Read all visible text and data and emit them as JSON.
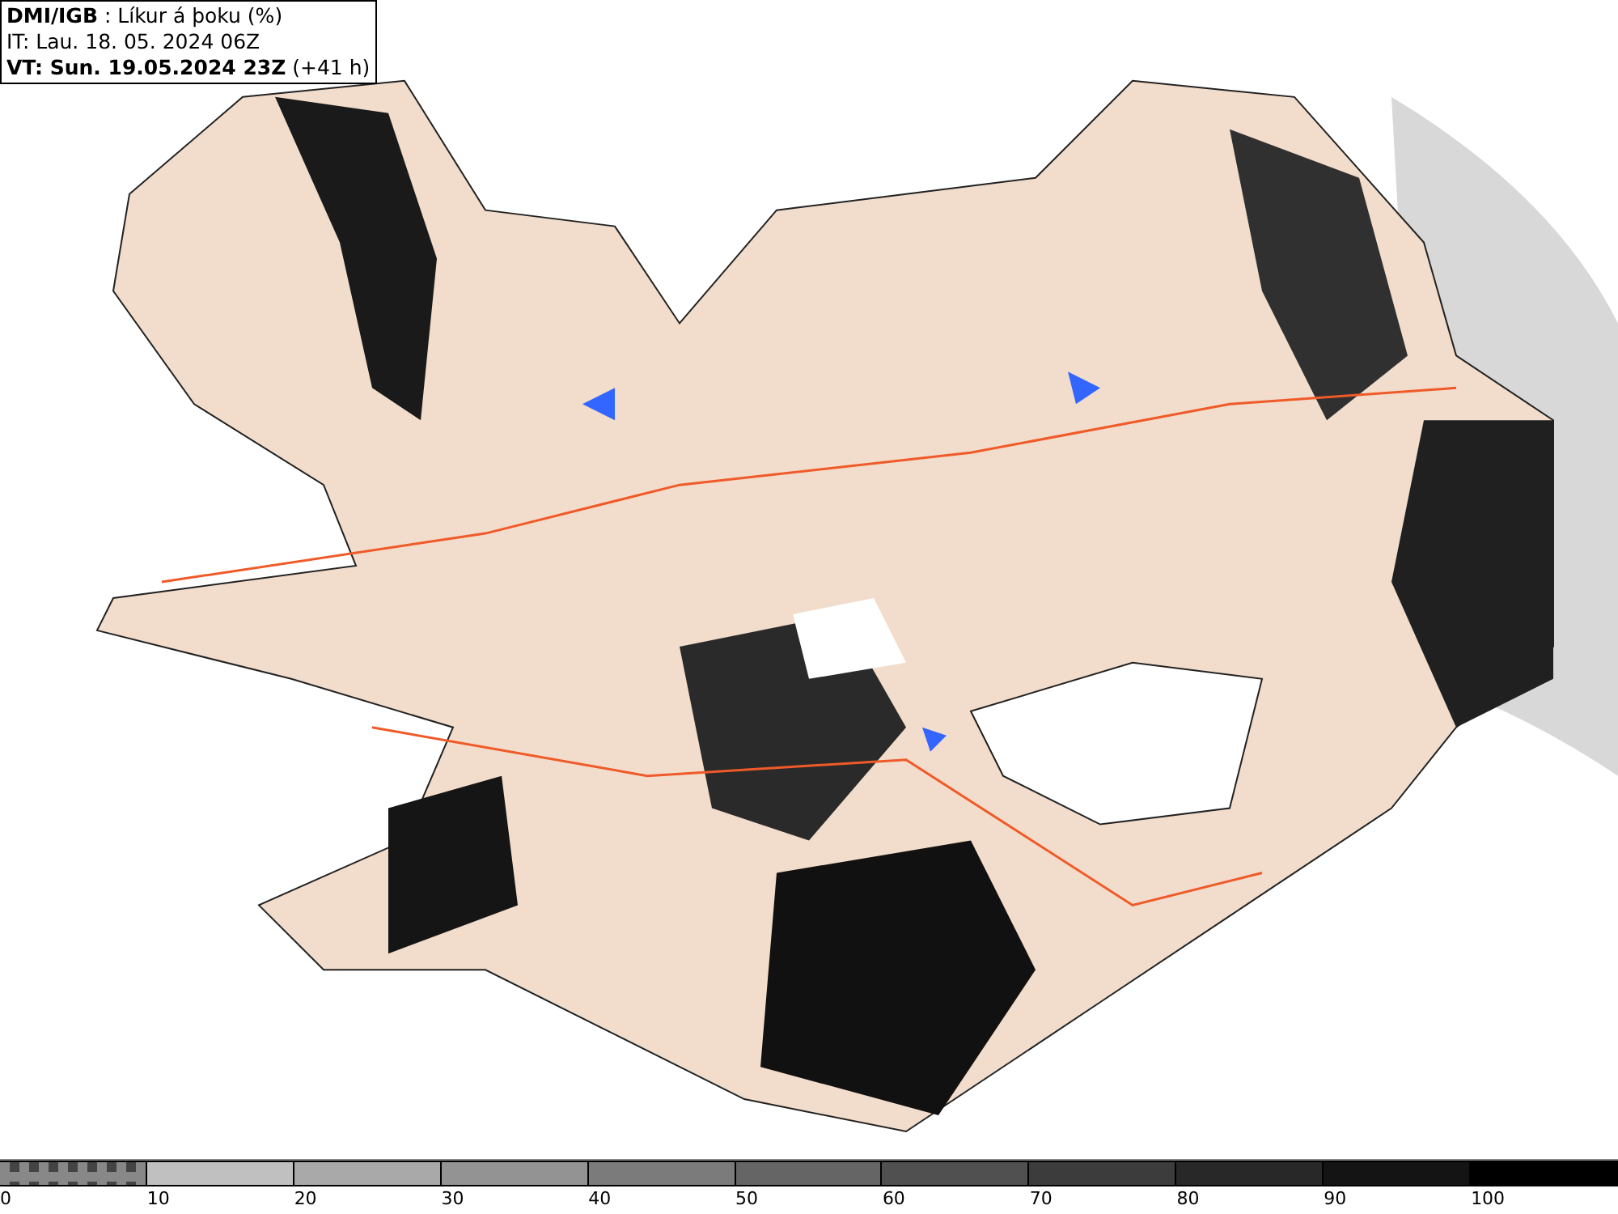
{
  "header": {
    "lines": [
      "**DMI/IGB** : Líkur á þoku (%)",
      "IT: Lau. 18. 05. 2024 06Z",
      "**VT: Sun. 19.05.2024 23Z** (+41 h)"
    ]
  },
  "legend": {
    "segments": [
      {
        "label": "0",
        "color": "#888888",
        "kind": "checker"
      },
      {
        "label": "10",
        "color": "#c0c0c0",
        "kind": "solid"
      },
      {
        "label": "20",
        "color": "#a9a9a9",
        "kind": "solid"
      },
      {
        "label": "30",
        "color": "#939393",
        "kind": "solid"
      },
      {
        "label": "40",
        "color": "#7b7b7b",
        "kind": "solid"
      },
      {
        "label": "50",
        "color": "#656565",
        "kind": "solid"
      },
      {
        "label": "60",
        "color": "#505050",
        "kind": "solid"
      },
      {
        "label": "70",
        "color": "#3c3c3c",
        "kind": "solid"
      },
      {
        "label": "80",
        "color": "#282828",
        "kind": "solid"
      },
      {
        "label": "90",
        "color": "#141414",
        "kind": "solid"
      },
      {
        "label": "100",
        "color": "#000000",
        "kind": "solid"
      }
    ]
  }
}
